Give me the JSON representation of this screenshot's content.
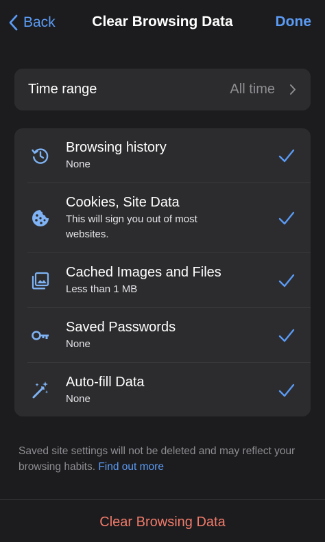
{
  "nav": {
    "back_label": "Back",
    "title": "Clear Browsing Data",
    "done_label": "Done"
  },
  "time_range": {
    "label": "Time range",
    "value": "All time"
  },
  "options": [
    {
      "title": "Browsing history",
      "subtitle": "None",
      "icon": "history-icon",
      "checked": true
    },
    {
      "title": "Cookies, Site Data",
      "subtitle": "This will sign you out of most websites.",
      "icon": "cookie-icon",
      "checked": true
    },
    {
      "title": "Cached Images and Files",
      "subtitle": "Less than 1 MB",
      "icon": "image-gallery-icon",
      "checked": true
    },
    {
      "title": "Saved Passwords",
      "subtitle": "None",
      "icon": "key-icon",
      "checked": true
    },
    {
      "title": "Auto-fill Data",
      "subtitle": "None",
      "icon": "magic-wand-icon",
      "checked": true
    }
  ],
  "footnote": {
    "text": "Saved site settings will not be deleted and may reflect your browsing habits.",
    "link": "Find out more"
  },
  "clear_button_label": "Clear Browsing Data",
  "colors": {
    "background": "#1c1c1e",
    "card": "#2c2c2e",
    "accent": "#5b9bf5",
    "destructive": "#f07a6a",
    "secondary_text": "#8e8e93"
  }
}
